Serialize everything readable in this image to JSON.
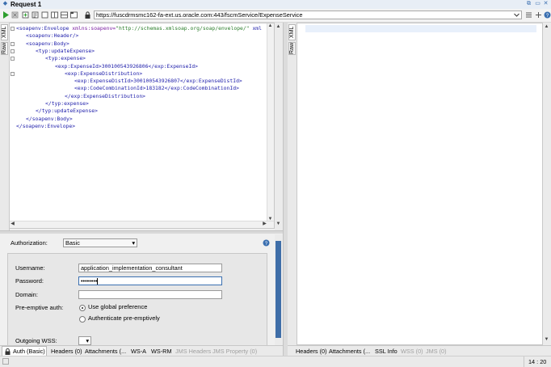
{
  "window": {
    "title": "Request 1"
  },
  "toolbar": {
    "url": "https://fuscdrmsmc162-fa-ext.us.oracle.com:443/fscmService/ExpenseService"
  },
  "request_tabs": {
    "xml": "XML",
    "raw": "Raw"
  },
  "response_tabs": {
    "xml": "XML",
    "raw": "Raw"
  },
  "xml_lines": [
    {
      "indent": 0,
      "open": "<soapenv:Envelope",
      "attr": " xmlns:soapenv=",
      "val": "\"http://schemas.xmlsoap.org/soap/envelope/\"",
      "rest": " xml"
    },
    {
      "indent": 1,
      "open": "<soapenv:Header/>",
      "attr": "",
      "val": "",
      "rest": ""
    },
    {
      "indent": 1,
      "open": "<soapenv:Body>",
      "attr": "",
      "val": "",
      "rest": ""
    },
    {
      "indent": 2,
      "open": "<typ:updateExpense>",
      "attr": "",
      "val": "",
      "rest": ""
    },
    {
      "indent": 3,
      "open": "<typ:expense>",
      "attr": "",
      "val": "",
      "rest": ""
    },
    {
      "indent": 4,
      "open": "<exp:ExpenseId>",
      "attr": "",
      "val": "",
      "rest": "300100543926806</exp:ExpenseId>"
    },
    {
      "indent": 5,
      "open": "<exp:ExpenseDistribution>",
      "attr": "",
      "val": "",
      "rest": ""
    },
    {
      "indent": 6,
      "open": "<exp:ExpenseDistId>",
      "attr": "",
      "val": "",
      "rest": "300100543926807</exp:ExpenseDistId>"
    },
    {
      "indent": 6,
      "open": "<exp:CodeCombinationId>",
      "attr": "",
      "val": "",
      "rest": "183182</exp:CodeCombinationId>"
    },
    {
      "indent": 5,
      "open": "</exp:ExpenseDistribution>",
      "attr": "",
      "val": "",
      "rest": ""
    },
    {
      "indent": 3,
      "open": "</typ:expense>",
      "attr": "",
      "val": "",
      "rest": ""
    },
    {
      "indent": 2,
      "open": "</typ:updateExpense>",
      "attr": "",
      "val": "",
      "rest": ""
    },
    {
      "indent": 1,
      "open": "</soapenv:Body>",
      "attr": "",
      "val": "",
      "rest": ""
    },
    {
      "indent": 0,
      "open": "</soapenv:Envelope>",
      "attr": "",
      "val": "",
      "rest": ""
    }
  ],
  "auth": {
    "authorization_label": "Authorization:",
    "authorization_value": "Basic",
    "username_label": "Username:",
    "username_value": "application_implementation_consultant",
    "password_label": "Password:",
    "password_value": "••••••••",
    "domain_label": "Domain:",
    "domain_value": "",
    "preemptive_label": "Pre-emptive auth:",
    "option_global": "Use global preference",
    "option_preemptive": "Authenticate pre-emptively",
    "outgoing_wss_label": "Outgoing WSS:"
  },
  "request_bottom_tabs": [
    {
      "label": "Auth (Basic)",
      "enabled": true
    },
    {
      "label": "Headers (0)",
      "enabled": true
    },
    {
      "label": "Attachments (...",
      "enabled": true
    },
    {
      "label": "WS-A",
      "enabled": true
    },
    {
      "label": "WS-RM",
      "enabled": true
    },
    {
      "label": "JMS Headers",
      "enabled": false
    },
    {
      "label": "JMS Property (0)",
      "enabled": false
    }
  ],
  "response_bottom_tabs": [
    {
      "label": "Headers (0)",
      "enabled": true
    },
    {
      "label": "Attachments (...",
      "enabled": true
    },
    {
      "label": "SSL Info",
      "enabled": true
    },
    {
      "label": "WSS (0)",
      "enabled": false
    },
    {
      "label": "JMS (0)",
      "enabled": false
    }
  ],
  "status": {
    "cursor": "14 : 20"
  },
  "colors": {
    "accent": "#3a6fb0",
    "run_green": "#2e9e2e",
    "tag_blue": "#1d1daa",
    "attr_purple": "#7b1fa2",
    "value_green": "#2a7d2a"
  }
}
